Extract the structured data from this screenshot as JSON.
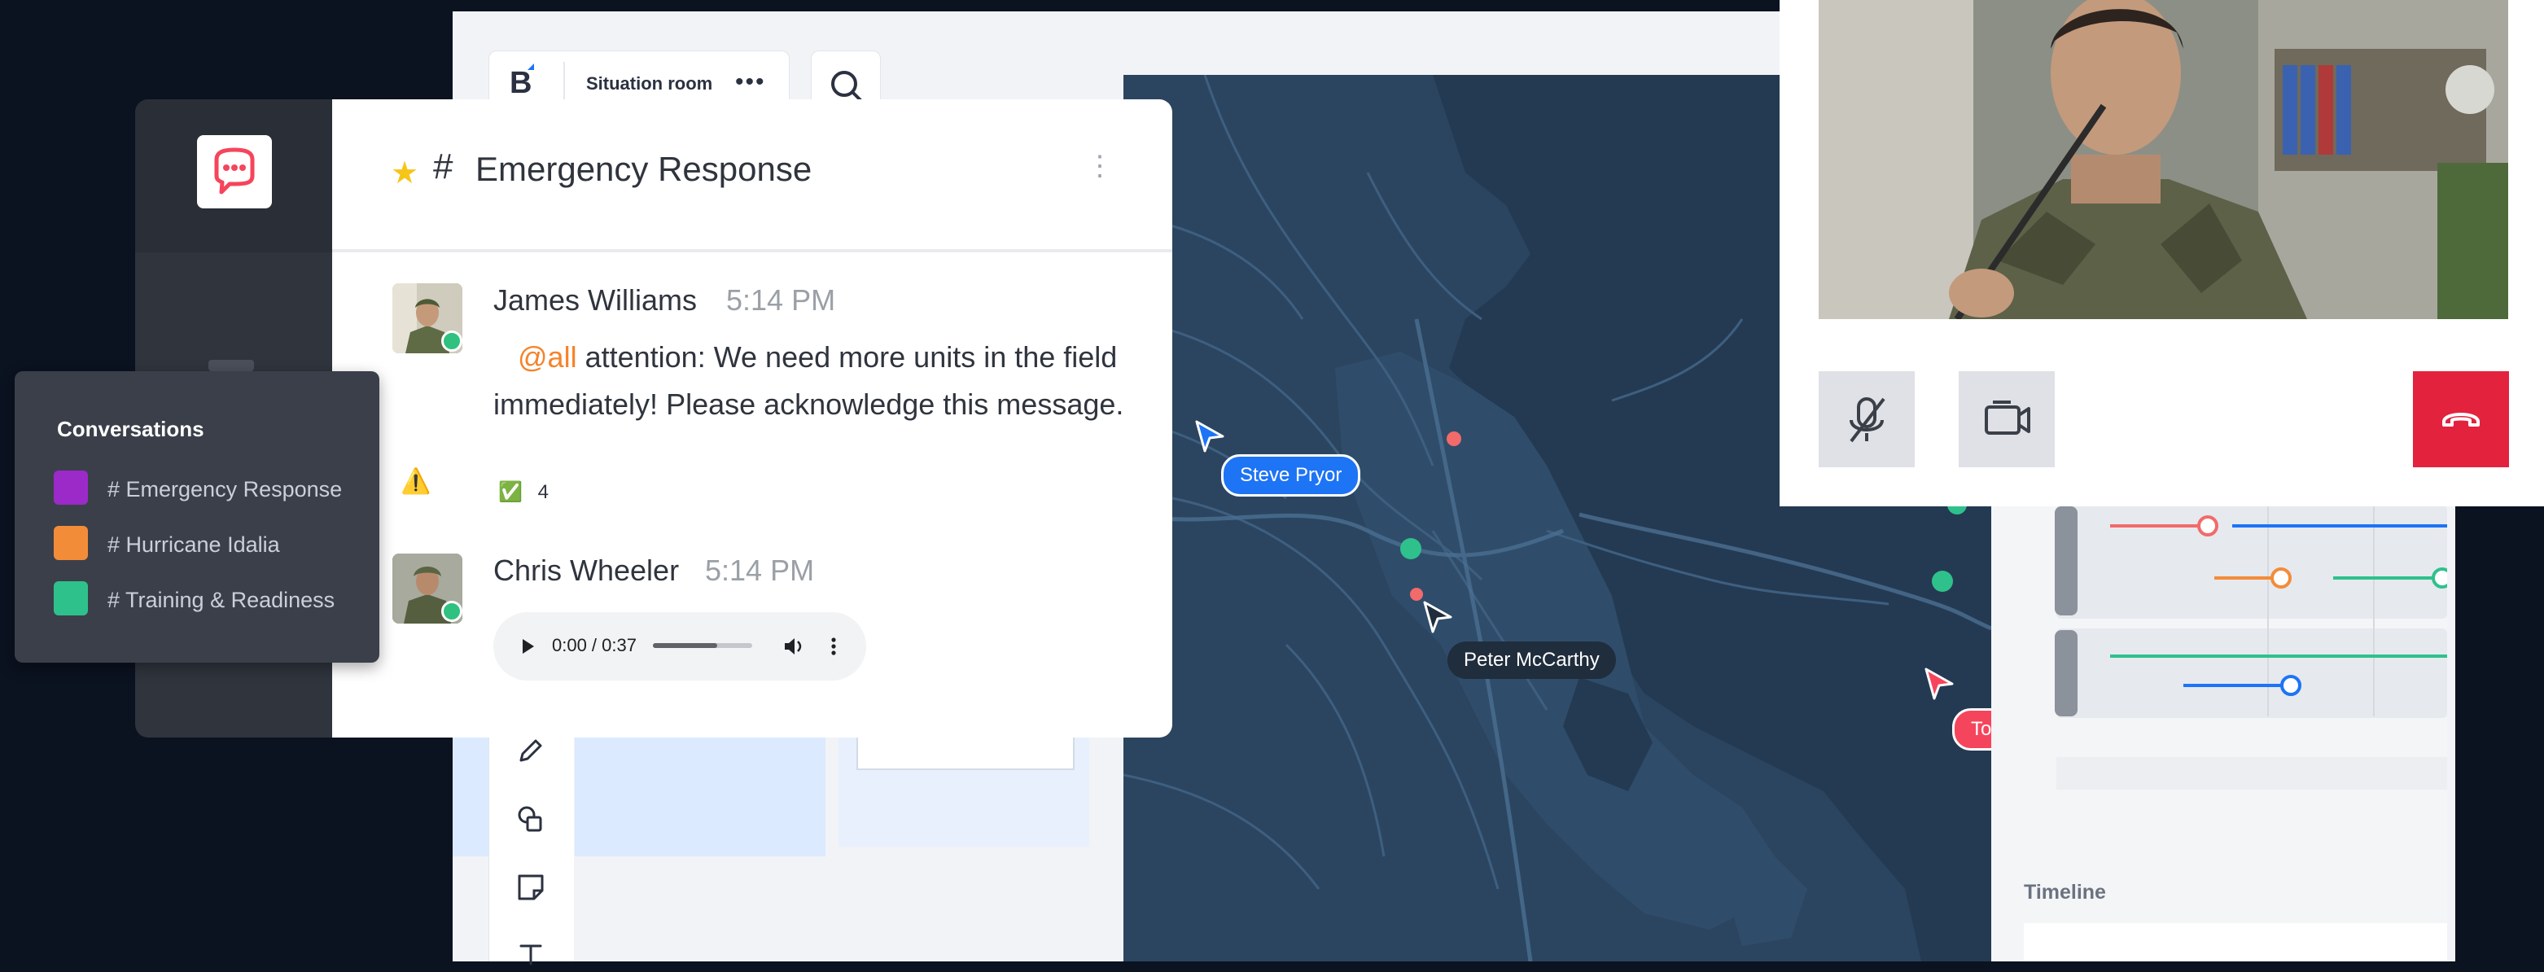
{
  "board": {
    "title": "Situation room",
    "more": "•••",
    "timeline_label": "Timeline"
  },
  "chat": {
    "room_hash": "#",
    "room_name": "Emergency Response",
    "kebab": "⋮",
    "messages": [
      {
        "author": "James Williams",
        "time": "5:14 PM",
        "mention": "@all",
        "text": "attention: We need more units in the field immediately! Please acknowledge this message.",
        "reaction_emoji": "✅",
        "reaction_count": "4"
      },
      {
        "author": "Chris Wheeler",
        "time": "5:14 PM",
        "audio_time": "0:00 / 0:37",
        "audio_progress": 0.65
      }
    ]
  },
  "conversations": {
    "title": "Conversations",
    "items": [
      {
        "label": "# Emergency Response",
        "color": "#9b2ac8"
      },
      {
        "label": "# Hurricane Idalia",
        "color": "#f38c39"
      },
      {
        "label": "# Training & Readiness",
        "color": "#2fc18c"
      }
    ]
  },
  "map": {
    "cursors": [
      {
        "name": "Steve Pryor",
        "color": "#1d74f5"
      },
      {
        "name": "Peter McCarthy",
        "color": "#1f2d3d"
      },
      {
        "name": "Tom Mersman",
        "color": "#f5455c"
      }
    ]
  },
  "colors": {
    "brand_red": "#f5455c",
    "accent_blue": "#1d74f5",
    "end_call": "#e3223e"
  }
}
